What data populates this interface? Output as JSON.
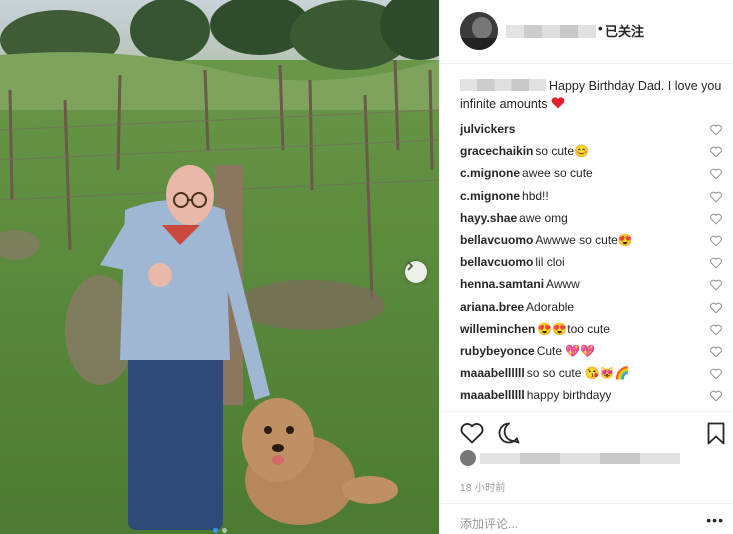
{
  "post": {
    "image_alt": "Elderly man in a light blue sweater pointing at the camera beside a golden doodle in a vineyard",
    "carousel": {
      "slide_count": 2,
      "active_index": 0
    }
  },
  "header": {
    "follow_separator": "•",
    "follow_label": "已关注"
  },
  "caption": {
    "text": "Happy Birthday Dad. I love you infinite amounts",
    "emoji": "❤️"
  },
  "comments": [
    {
      "user": "julvickers",
      "text": "  "
    },
    {
      "user": "gracechaikin",
      "text": "so cute😊"
    },
    {
      "user": "c.mignone",
      "text": "awee so cute"
    },
    {
      "user": "c.mignone",
      "text": "hbd!!"
    },
    {
      "user": "hayy.shae",
      "text": "awe omg"
    },
    {
      "user": "bellavcuomo",
      "text": "Awwwe so cute😍"
    },
    {
      "user": "bellavcuomo",
      "text": "lil cloi"
    },
    {
      "user": "henna.samtani",
      "text": "Awww"
    },
    {
      "user": "ariana.bree",
      "text": "Adorable"
    },
    {
      "user": "willeminchen",
      "text": "😍😍too cute"
    },
    {
      "user": "rubybeyonce",
      "text": "Cute 💖💖"
    },
    {
      "user": "maaabellllll",
      "text": "so so cute 😘😻🌈"
    },
    {
      "user": "maaabellllll",
      "text": "happy birthdayy"
    }
  ],
  "footer": {
    "timestamp": "18 小时前",
    "add_comment_placeholder": "添加评论...",
    "more_label": "•••"
  },
  "colors": {
    "accent": "#3897f0",
    "heart": "#ed4956",
    "text": "#262626",
    "muted": "#999999"
  }
}
